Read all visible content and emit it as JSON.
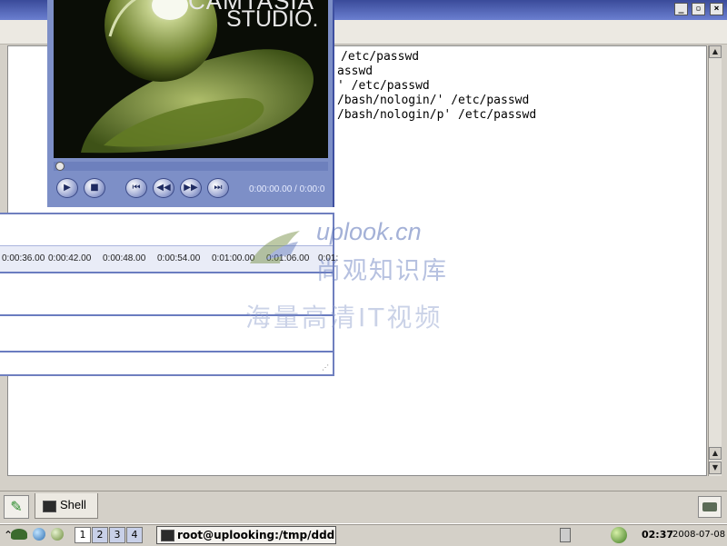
{
  "terminal": {
    "lines": [
      "/etc/passwd",
      "asswd",
      "' /etc/passwd",
      "/bash/nologin/' /etc/passwd",
      "/bash/nologin/p' /etc/passwd"
    ],
    "tab_label": "Shell",
    "titlebar_color": "#4a5fbf"
  },
  "player": {
    "brand_line1": "CAMTASIA",
    "brand_line2": "STUDIO.",
    "time": "0:00:00.00 / 0:00:0",
    "progress": 0.0
  },
  "timeline": {
    "ticks": [
      "0:00:36.00",
      "0:00:42.00",
      "0:00:48.00",
      "0:00:54.00",
      "0:01:00.00",
      "0:01:06.00",
      "0:01:"
    ]
  },
  "watermark": {
    "domain": "uplook.cn",
    "line1": "尚观知识库",
    "line2": "海量高清IT视频"
  },
  "panel": {
    "desktops": [
      "1",
      "2",
      "3",
      "4"
    ],
    "active_desktop": "1",
    "task_title": "root@uplooking:/tmp/ddd",
    "clock": "02:37",
    "date": "2008-07-08"
  }
}
